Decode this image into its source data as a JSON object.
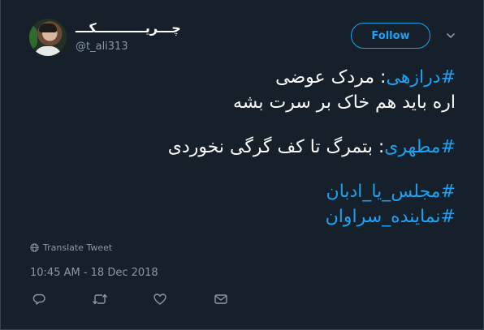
{
  "user": {
    "display_name": "چـــریـــــــــــکـــ",
    "handle": "@t_ali313"
  },
  "follow_label": "Follow",
  "tweet": {
    "line1_hashtag": "#درازهی",
    "line1_text": ": مردک عوضی",
    "line2_text": "اره باید هم خاک بر سرت بشه",
    "line3_hashtag": "#مطهری",
    "line3_text": ": بتمرگ تا کف گرگی نخوردی",
    "hashtag_1": "#مجلس_یا_ادبان",
    "hashtag_2": "#نماینده_سراوان"
  },
  "translate_label": "Translate Tweet",
  "timestamp": "10:45 AM - 18 Dec 2018",
  "icons": {
    "globe": "globe-icon",
    "more": "chevron-down-icon",
    "reply": "reply-icon",
    "retweet": "retweet-icon",
    "like": "heart-icon",
    "message": "envelope-icon"
  },
  "colors": {
    "background": "#15202b",
    "accent": "#1da1f2",
    "muted": "#8899a6"
  }
}
